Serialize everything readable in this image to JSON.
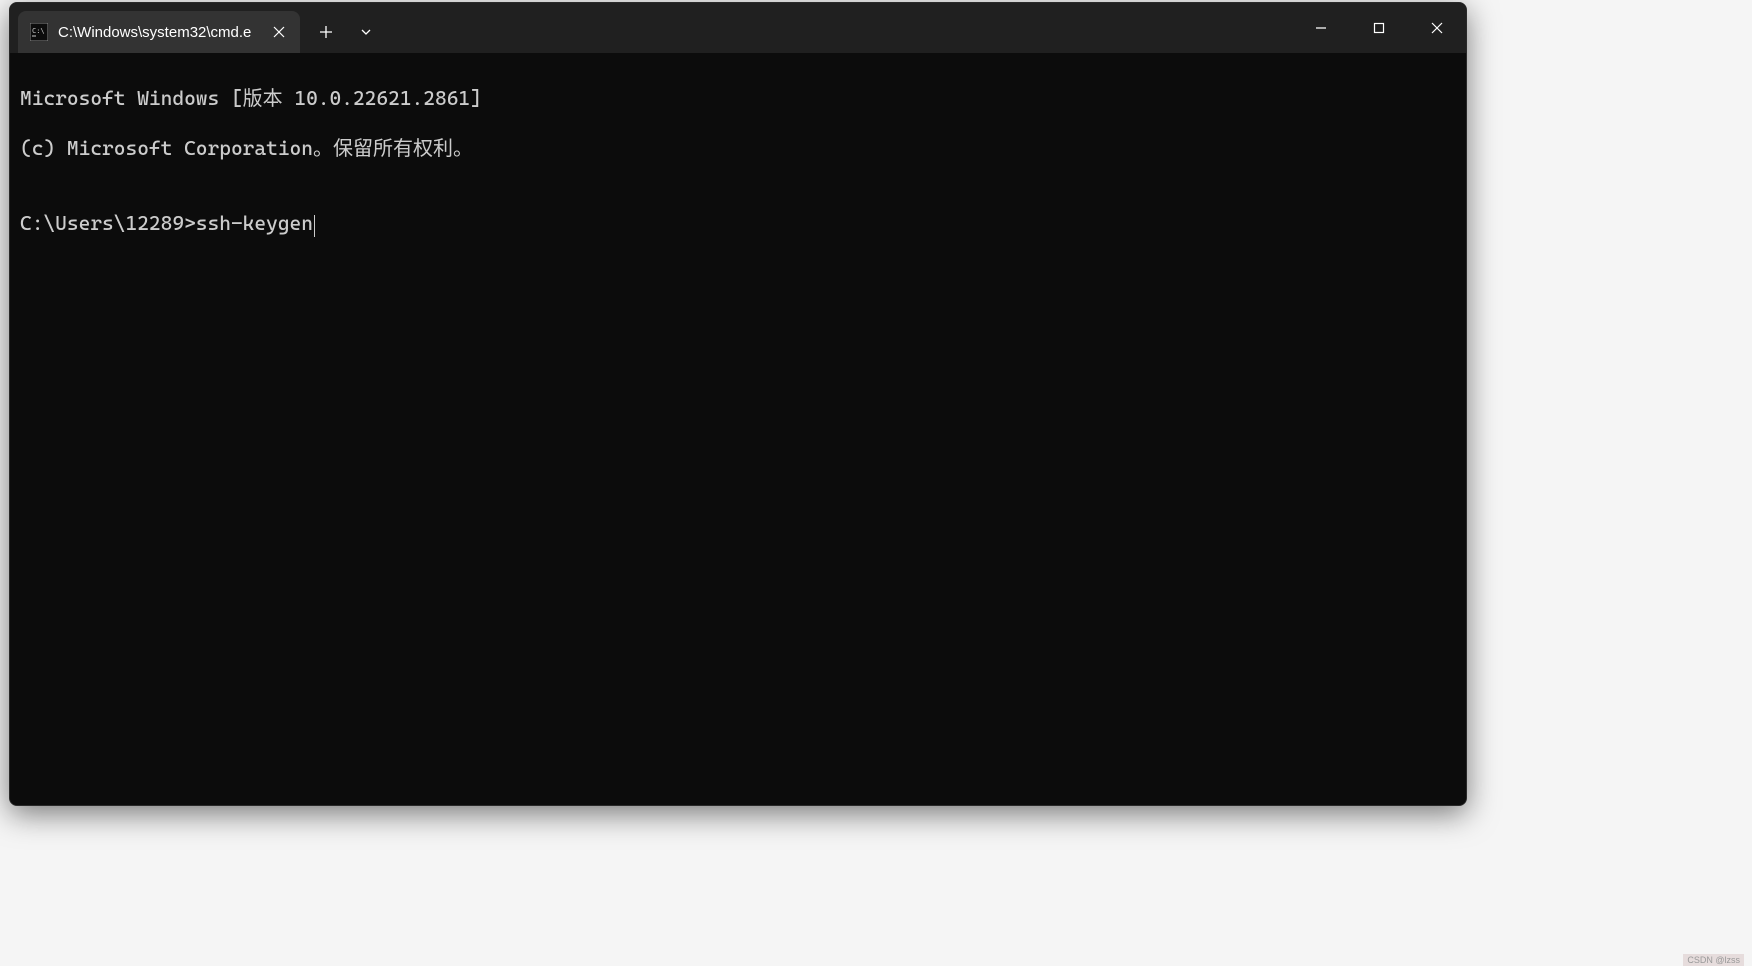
{
  "window": {
    "tab_title": "C:\\Windows\\system32\\cmd.e",
    "controls": {
      "minimize": "minimize",
      "maximize": "maximize",
      "close": "close"
    }
  },
  "terminal": {
    "line1": "Microsoft Windows [版本 10.0.22621.2861]",
    "line2": "(c) Microsoft Corporation。保留所有权利。",
    "blank": "",
    "prompt": "C:\\Users\\12289>",
    "command": "ssh-keygen"
  },
  "watermark": "CSDN @lzss"
}
